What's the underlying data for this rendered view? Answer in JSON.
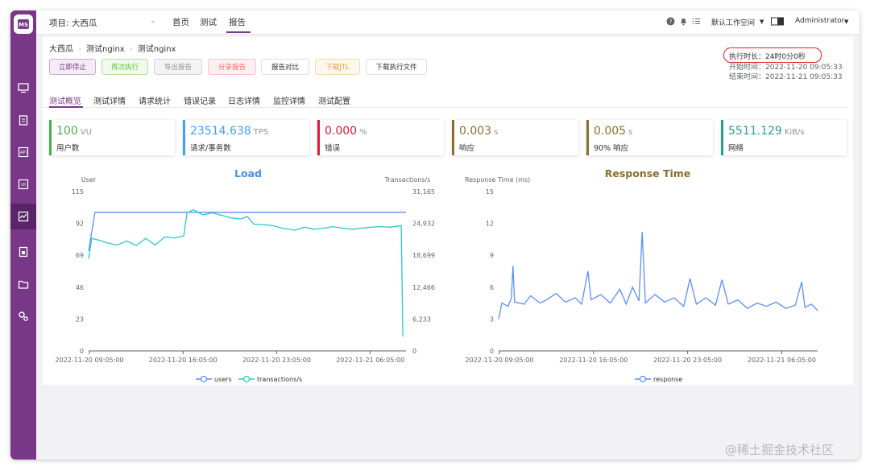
{
  "project": {
    "label": "项目: 大西瓜"
  },
  "nav": [
    "首页",
    "测试",
    "报告"
  ],
  "topright": {
    "workspace": "默认工作空间",
    "user": "Administrator"
  },
  "breadcrumb": [
    "大西瓜",
    "测试nginx",
    "测试nginx"
  ],
  "buttons": [
    "立即停止",
    "再次执行",
    "导出报告",
    "分享报告",
    "报告对比",
    "下载JTL",
    "下载执行文件"
  ],
  "meta": {
    "duration": "执行时长：24时0分0秒",
    "start": "开始时间：2022-11-20 09:05:33",
    "end": "结束时间：2022-11-21 09:05:33"
  },
  "tabs": [
    "测试概览",
    "测试详情",
    "请求统计",
    "错误记录",
    "日志详情",
    "监控详情",
    "测试配置"
  ],
  "cards": [
    {
      "value": "100",
      "unit": "VU",
      "label": "用户数",
      "color": "#4caf50"
    },
    {
      "value": "23514.638",
      "unit": "TPS",
      "label": "请求/事务数",
      "color": "#409eff"
    },
    {
      "value": "0.000",
      "unit": "%",
      "label": "错误",
      "color": "#e6173c"
    },
    {
      "value": "0.003",
      "unit": "s",
      "label": "响应",
      "color": "#8a6e2e"
    },
    {
      "value": "0.005",
      "unit": "s",
      "label": "90% 响应",
      "color": "#8a6e2e"
    },
    {
      "value": "5511.129",
      "unit": "KiB/s",
      "label": "网络",
      "color": "#2a9d8f"
    }
  ],
  "watermark": "@稀土掘金技术社区",
  "chart_data": [
    {
      "type": "line",
      "title": "Load",
      "ylabel_left": "User",
      "ylabel_right": "Transactions/s",
      "y_left_ticks": [
        "115",
        "92",
        "69",
        "46",
        "23",
        "0"
      ],
      "y_right_ticks": [
        "31,165",
        "24,932",
        "18,699",
        "12,466",
        "6,233",
        "0"
      ],
      "ylim_left": [
        0,
        115
      ],
      "ylim_right": [
        0,
        31165
      ],
      "x_ticks": [
        "2022-11-20 09:05:00",
        "2022-11-20 16:05:00",
        "2022-11-20 23:05:00",
        "2022-11-21 06:05:00"
      ],
      "legend": "bottom-center",
      "series": [
        {
          "name": "users",
          "axis": "left",
          "color": "#5b8ff9",
          "points": [
            [
              0,
              72
            ],
            [
              0.02,
              100
            ],
            [
              1,
              100
            ]
          ]
        },
        {
          "name": "transactions/s",
          "axis": "right",
          "color": "#2ec7c9",
          "points": [
            [
              0,
              18000
            ],
            [
              0.01,
              22000
            ],
            [
              0.03,
              21700
            ],
            [
              0.06,
              21100
            ],
            [
              0.09,
              20700
            ],
            [
              0.12,
              21500
            ],
            [
              0.15,
              20600
            ],
            [
              0.18,
              22000
            ],
            [
              0.21,
              20700
            ],
            [
              0.24,
              22300
            ],
            [
              0.27,
              22100
            ],
            [
              0.3,
              22500
            ],
            [
              0.31,
              27000
            ],
            [
              0.33,
              27600
            ],
            [
              0.36,
              26600
            ],
            [
              0.39,
              27000
            ],
            [
              0.42,
              26500
            ],
            [
              0.45,
              26000
            ],
            [
              0.48,
              25800
            ],
            [
              0.5,
              26300
            ],
            [
              0.52,
              24800
            ],
            [
              0.55,
              24700
            ],
            [
              0.58,
              24500
            ],
            [
              0.61,
              24000
            ],
            [
              0.65,
              23600
            ],
            [
              0.68,
              24200
            ],
            [
              0.71,
              23800
            ],
            [
              0.74,
              24000
            ],
            [
              0.77,
              24300
            ],
            [
              0.8,
              24000
            ],
            [
              0.83,
              23800
            ],
            [
              0.86,
              24000
            ],
            [
              0.89,
              24200
            ],
            [
              0.92,
              24300
            ],
            [
              0.95,
              24200
            ],
            [
              0.985,
              24500
            ],
            [
              0.99,
              2800
            ]
          ]
        }
      ]
    },
    {
      "type": "line",
      "title": "Response Time",
      "ylabel": "Response Time (ms)",
      "y_ticks": [
        "15",
        "12",
        "9",
        "6",
        "3",
        "0"
      ],
      "ylim": [
        0,
        15
      ],
      "x_ticks": [
        "2022-11-20 09:05:00",
        "2022-11-20 16:05:00",
        "2022-11-20 23:05:00",
        "2022-11-21 06:05:00"
      ],
      "legend": "bottom-center",
      "series": [
        {
          "name": "response",
          "color": "#5b8ff9",
          "points": [
            [
              0,
              3.0
            ],
            [
              0.01,
              4.5
            ],
            [
              0.03,
              4.2
            ],
            [
              0.04,
              5.0
            ],
            [
              0.045,
              8.0
            ],
            [
              0.05,
              4.6
            ],
            [
              0.08,
              4.4
            ],
            [
              0.1,
              5.2
            ],
            [
              0.13,
              4.5
            ],
            [
              0.15,
              4.8
            ],
            [
              0.18,
              5.4
            ],
            [
              0.21,
              4.6
            ],
            [
              0.24,
              5.0
            ],
            [
              0.26,
              4.4
            ],
            [
              0.28,
              7.5
            ],
            [
              0.29,
              4.8
            ],
            [
              0.32,
              5.3
            ],
            [
              0.35,
              4.5
            ],
            [
              0.38,
              5.8
            ],
            [
              0.4,
              4.4
            ],
            [
              0.42,
              6.0
            ],
            [
              0.44,
              4.7
            ],
            [
              0.45,
              11.2
            ],
            [
              0.46,
              4.5
            ],
            [
              0.49,
              5.3
            ],
            [
              0.52,
              4.6
            ],
            [
              0.55,
              5.0
            ],
            [
              0.58,
              4.2
            ],
            [
              0.6,
              6.8
            ],
            [
              0.62,
              4.4
            ],
            [
              0.65,
              5.0
            ],
            [
              0.68,
              4.3
            ],
            [
              0.7,
              6.7
            ],
            [
              0.72,
              4.4
            ],
            [
              0.75,
              4.8
            ],
            [
              0.78,
              4.0
            ],
            [
              0.81,
              4.5
            ],
            [
              0.84,
              4.2
            ],
            [
              0.87,
              4.6
            ],
            [
              0.9,
              4.0
            ],
            [
              0.93,
              4.3
            ],
            [
              0.95,
              6.5
            ],
            [
              0.96,
              4.1
            ],
            [
              0.98,
              4.4
            ],
            [
              1,
              3.8
            ]
          ]
        }
      ]
    }
  ]
}
